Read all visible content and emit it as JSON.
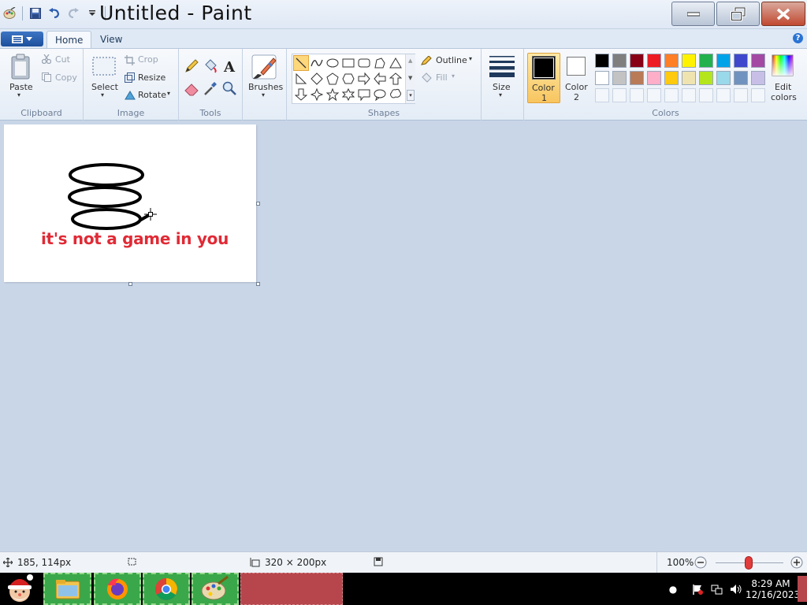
{
  "window": {
    "title": "Untitled - Paint"
  },
  "tabs": {
    "home": "Home",
    "view": "View"
  },
  "clipboard": {
    "paste": "Paste",
    "cut": "Cut",
    "copy": "Copy",
    "group": "Clipboard"
  },
  "image": {
    "select": "Select",
    "crop": "Crop",
    "resize": "Resize",
    "rotate": "Rotate",
    "group": "Image"
  },
  "tools": {
    "group": "Tools"
  },
  "brushes": {
    "label": "Brushes"
  },
  "shapes": {
    "group": "Shapes",
    "outline": "Outline",
    "fill": "Fill"
  },
  "size": {
    "label": "Size"
  },
  "colors": {
    "color1_label": "Color",
    "color1_num": "1",
    "color2_label": "Color",
    "color2_num": "2",
    "edit_label": "Edit",
    "edit_label2": "colors",
    "group": "Colors",
    "color1": "#000000",
    "color2": "#ffffff",
    "palette_row1": [
      "#000000",
      "#7f7f7f",
      "#880015",
      "#ed1c24",
      "#ff7f27",
      "#fff200",
      "#22b14c",
      "#00a2e8",
      "#3f48cc",
      "#a349a4"
    ],
    "palette_row2": [
      "#ffffff",
      "#c3c3c3",
      "#b97a57",
      "#ffaec9",
      "#ffc90e",
      "#efe4b0",
      "#b5e61d",
      "#99d9ea",
      "#7092be",
      "#c8bfe7"
    ]
  },
  "canvas": {
    "text": "it's not a game in you",
    "text_color": "#e02a35"
  },
  "status": {
    "cursor_pos": "185, 114px",
    "image_size": "320 × 200px",
    "zoom": "100%"
  },
  "taskbar": {
    "time": "8:29 AM",
    "date": "12/16/2023"
  }
}
